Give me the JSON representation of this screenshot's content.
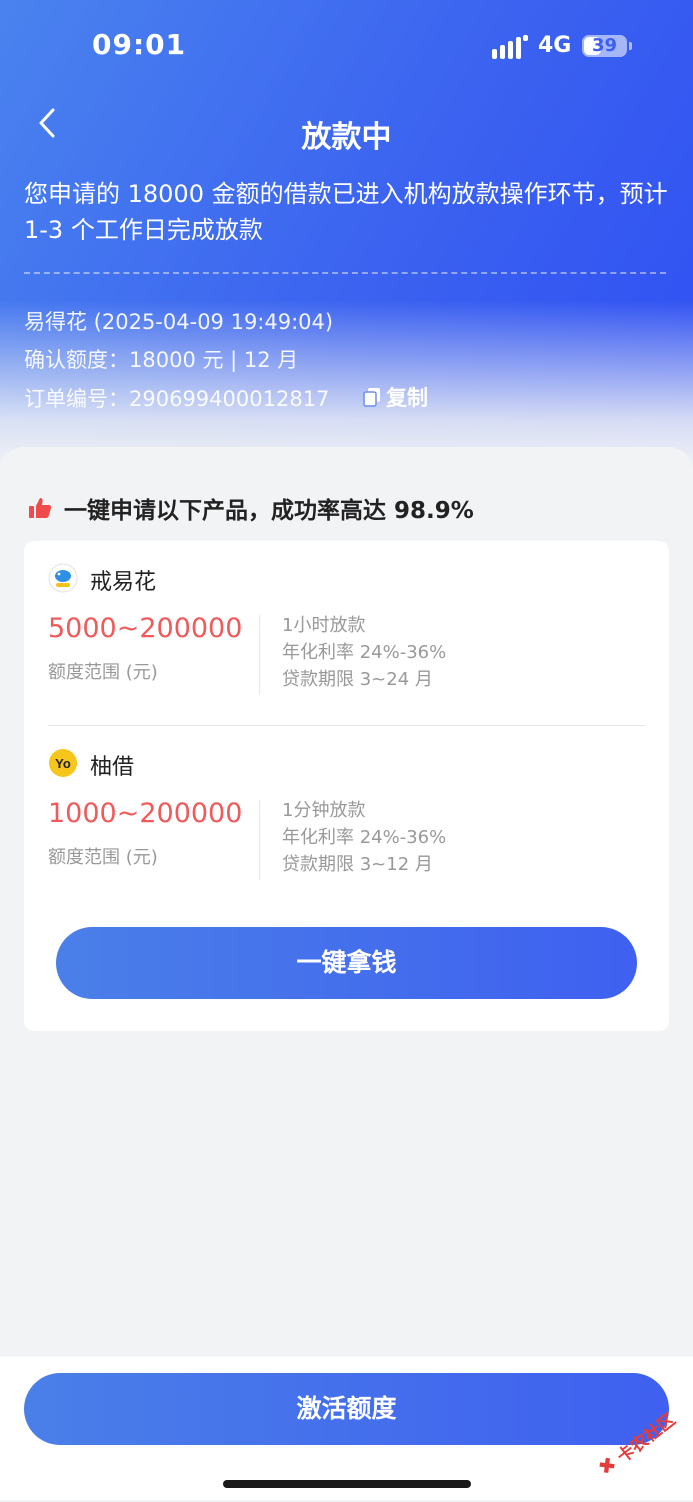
{
  "status_bar": {
    "time": "09:01",
    "network": "4G",
    "battery": "39"
  },
  "header": {
    "title": "放款中"
  },
  "notice": {
    "text": "您申请的 18000 金额的借款已进入机构放款操作环节，预计 1-3 个工作日完成放款"
  },
  "order": {
    "lender_line": "易得花 (2025-04-09 19:49:04)",
    "amount_line": "确认额度：18000 元 | 12 月",
    "order_no_line": "订单编号：290699400012817",
    "copy_label": "复制"
  },
  "promo": {
    "text": "一键申请以下产品，成功率高达 98.9%"
  },
  "products": [
    {
      "name": "戒易花",
      "range": "5000~200000",
      "range_label": "额度范围 (元)",
      "features": [
        "1小时放款",
        "年化利率 24%-36%",
        "贷款期限 3~24 月"
      ]
    },
    {
      "name": "柚借",
      "range": "1000~200000",
      "range_label": "额度范围 (元)",
      "features": [
        "1分钟放款",
        "年化利率 24%-36%",
        "贷款期限 3~12 月"
      ]
    }
  ],
  "buttons": {
    "grab_money": "一键拿钱",
    "activate": "激活额度"
  },
  "watermark": {
    "text": "卡农社区"
  },
  "colors": {
    "accent": "#3f60f0",
    "amount_red": "#ef5a5a",
    "thumb_red": "#ef4b4b"
  },
  "icons": {
    "back": "chevron-left-icon",
    "copy": "copy-icon",
    "promo": "thumbs-up-icon"
  }
}
